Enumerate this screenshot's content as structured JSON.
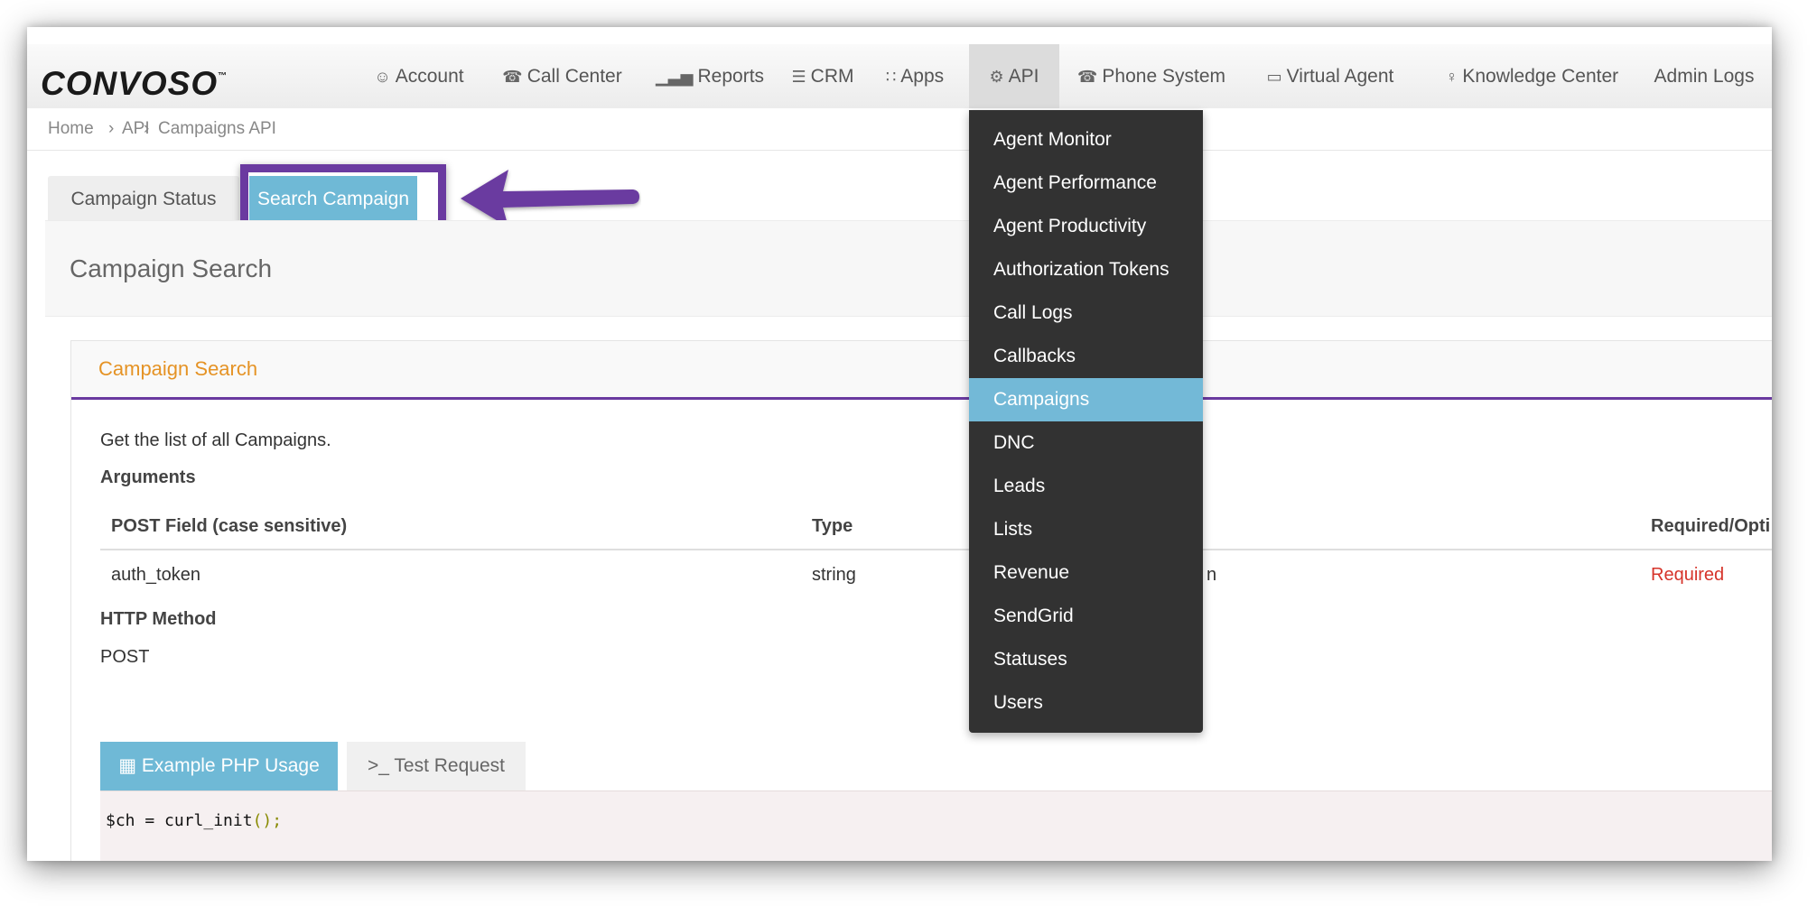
{
  "brand": {
    "logo_text": "CONVOSO",
    "logo_mark": "™"
  },
  "nav": {
    "items": [
      {
        "label": "Account",
        "icon": "user-icon",
        "glyph": "☺"
      },
      {
        "label": "Call Center",
        "icon": "phone-icon",
        "glyph": "☎"
      },
      {
        "label": "Reports",
        "icon": "bar-chart-icon",
        "glyph": "▁▃▅"
      },
      {
        "label": "CRM",
        "icon": "list-icon",
        "glyph": "☰"
      },
      {
        "label": "Apps",
        "icon": "grid-icon",
        "glyph": "∷"
      },
      {
        "label": "API",
        "icon": "gear-icon",
        "glyph": "⚙"
      },
      {
        "label": "Phone System",
        "icon": "phone-icon",
        "glyph": "☎"
      },
      {
        "label": "Virtual Agent",
        "icon": "monitor-icon",
        "glyph": "▭"
      },
      {
        "label": "Knowledge Center",
        "icon": "lightbulb-icon",
        "glyph": "♀"
      },
      {
        "label": "Admin Logs",
        "icon": "",
        "glyph": ""
      }
    ]
  },
  "breadcrumb": {
    "items": [
      "Home",
      "API",
      "Campaigns API"
    ],
    "separator": "›"
  },
  "tabs": {
    "status": "Campaign Status",
    "search": "Search Campaign"
  },
  "page": {
    "title": "Campaign Search",
    "card_title": "Campaign Search",
    "description": "Get the list of all Campaigns.",
    "arguments_label": "Arguments",
    "table": {
      "headers": [
        "POST Field (case sensitive)",
        "Type",
        "Required/Opti"
      ],
      "row": {
        "field": "auth_token",
        "type": "string",
        "desc_tail": "n",
        "required": "Required"
      }
    },
    "http_method_label": "HTTP Method",
    "http_method": "POST"
  },
  "code_tabs": {
    "php": "Example PHP Usage",
    "test": "Test Request",
    "test_glyph": ">_"
  },
  "code": {
    "var": "$ch = ",
    "fn": "curl_init",
    "rest": "();"
  },
  "api_menu": {
    "items": [
      "Agent Monitor",
      "Agent Performance",
      "Agent Productivity",
      "Authorization Tokens",
      "Call Logs",
      "Callbacks",
      "Campaigns",
      "DNC",
      "Leads",
      "Lists",
      "Revenue",
      "SendGrid",
      "Statuses",
      "Users"
    ],
    "selected": "Campaigns"
  },
  "colors": {
    "accent": "#6fb9d6",
    "highlight": "#6a3aa0",
    "orange": "#e59325",
    "required": "#d6332a",
    "menu_bg": "#323232"
  }
}
